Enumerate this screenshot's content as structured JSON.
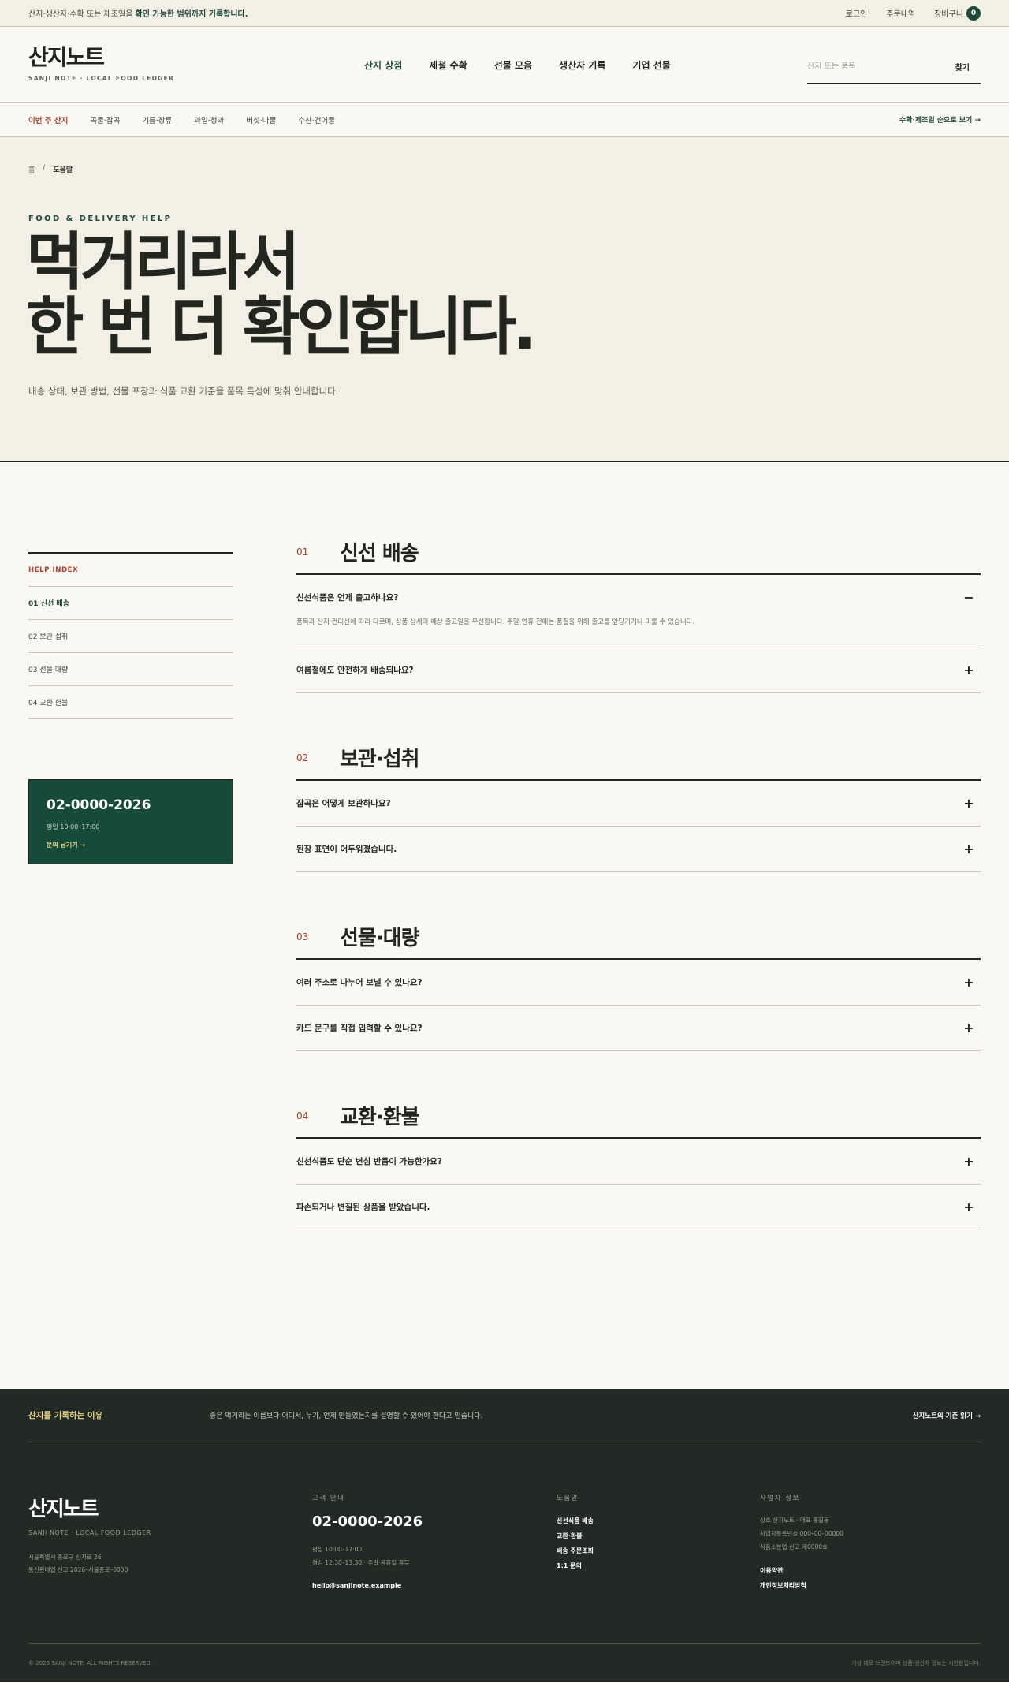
{
  "topbar": {
    "notice_prefix": "산지·생산자·수확 또는 제조일을 ",
    "notice_bold": "확인 가능한 범위까지 기록합니다.",
    "login": "로그인",
    "orders": "주문내역",
    "cart": "장바구니",
    "cart_count": "0"
  },
  "header": {
    "logo": "산지노트",
    "logo_sub": "SANJI NOTE · LOCAL FOOD LEDGER",
    "nav": [
      "산지 상점",
      "제철 수확",
      "선물 모음",
      "생산자 기록",
      "기업 선물"
    ],
    "search_placeholder": "산지 또는 품목",
    "search_button": "찾기"
  },
  "categories": {
    "items": [
      "이번 주 산지",
      "곡물·잡곡",
      "기름·장류",
      "과일·청과",
      "버섯·나물",
      "수산·건어물"
    ],
    "season_link": "수확·제조일 순으로 보기 →"
  },
  "hero": {
    "breadcrumb_home": "홈",
    "breadcrumb_sep": "/",
    "breadcrumb_current": "도움말",
    "eyebrow": "FOOD & DELIVERY HELP",
    "title_line1": "먹거리라서",
    "title_line2": "한 번 더 확인합니다",
    "title_dot": ".",
    "desc": "배송 상태, 보관 방법, 선물 포장과 식품 교환 기준을 품목 특성에 맞춰 안내합니다."
  },
  "sidebar": {
    "head": "HELP INDEX",
    "items": [
      "01 신선 배송",
      "02 보관·섭취",
      "03 선물·대량",
      "04 교환·환불"
    ],
    "contact_phone": "02-0000-2026",
    "contact_hours": "평일 10:00–17:00",
    "contact_link": "문의 남기기 →"
  },
  "faq": {
    "sections": [
      {
        "num": "01",
        "title": "신선 배송",
        "items": [
          {
            "q": "신선식품은 언제 출고하나요?",
            "a": "품목과 산지 컨디션에 따라 다르며, 상품 상세의 예상 출고일을 우선합니다. 주말·연휴 전에는 품질을 위해 출고를 앞당기거나 미룰 수 있습니다.",
            "open": true
          },
          {
            "q": "여름철에도 안전하게 배송되나요?"
          }
        ]
      },
      {
        "num": "02",
        "title": "보관·섭취",
        "items": [
          {
            "q": "잡곡은 어떻게 보관하나요?"
          },
          {
            "q": "된장 표면이 어두워졌습니다."
          }
        ]
      },
      {
        "num": "03",
        "title": "선물·대량",
        "items": [
          {
            "q": "여러 주소로 나누어 보낼 수 있나요?"
          },
          {
            "q": "카드 문구를 직접 입력할 수 있나요?"
          }
        ]
      },
      {
        "num": "04",
        "title": "교환·환불",
        "items": [
          {
            "q": "신선식품도 단순 변심 반품이 가능한가요?"
          },
          {
            "q": "파손되거나 변질된 상품을 받았습니다."
          }
        ]
      }
    ],
    "toggle_open": "−",
    "toggle_closed": "+"
  },
  "footer": {
    "why_title": "산지를 기록하는 이유",
    "why_desc": "좋은 먹거리는 이름보다 어디서, 누가, 언제 만들었는지를 설명할 수 있어야 한다고 믿습니다.",
    "standard_link": "산지노트의 기준 읽기 →",
    "logo": "산지노트",
    "logo_sub": "SANJI NOTE · LOCAL FOOD LEDGER",
    "address1": "서울특별시 종로구 산지로 26",
    "address2": "통신판매업 신고 2026–서울종로–0000",
    "cs_title": "고객 안내",
    "cs_phone": "02-0000-2026",
    "cs_hours1": "평일 10:00–17:00",
    "cs_hours2": "점심 12:30–13:30 · 주말·공휴일 휴무",
    "cs_email": "hello@sanjinote.example",
    "help_title": "도움말",
    "help_links": [
      "신선식품 배송",
      "교환·환불",
      "배송 주문조회",
      "1:1 문의"
    ],
    "biz_title": "사업자 정보",
    "biz_lines": [
      "상호 산지노트 · 대표 홍길동",
      "사업자등록번호 000–00–00000",
      "식품소분업 신고 제0000호"
    ],
    "biz_links": [
      "이용약관",
      "개인정보처리방침"
    ],
    "copyright": "© 2026 SANJI NOTE. ALL RIGHTS RESERVED.",
    "disclaimer": "가상 데모 브랜드이며 상품·생산자 정보는 시안용입니다."
  }
}
